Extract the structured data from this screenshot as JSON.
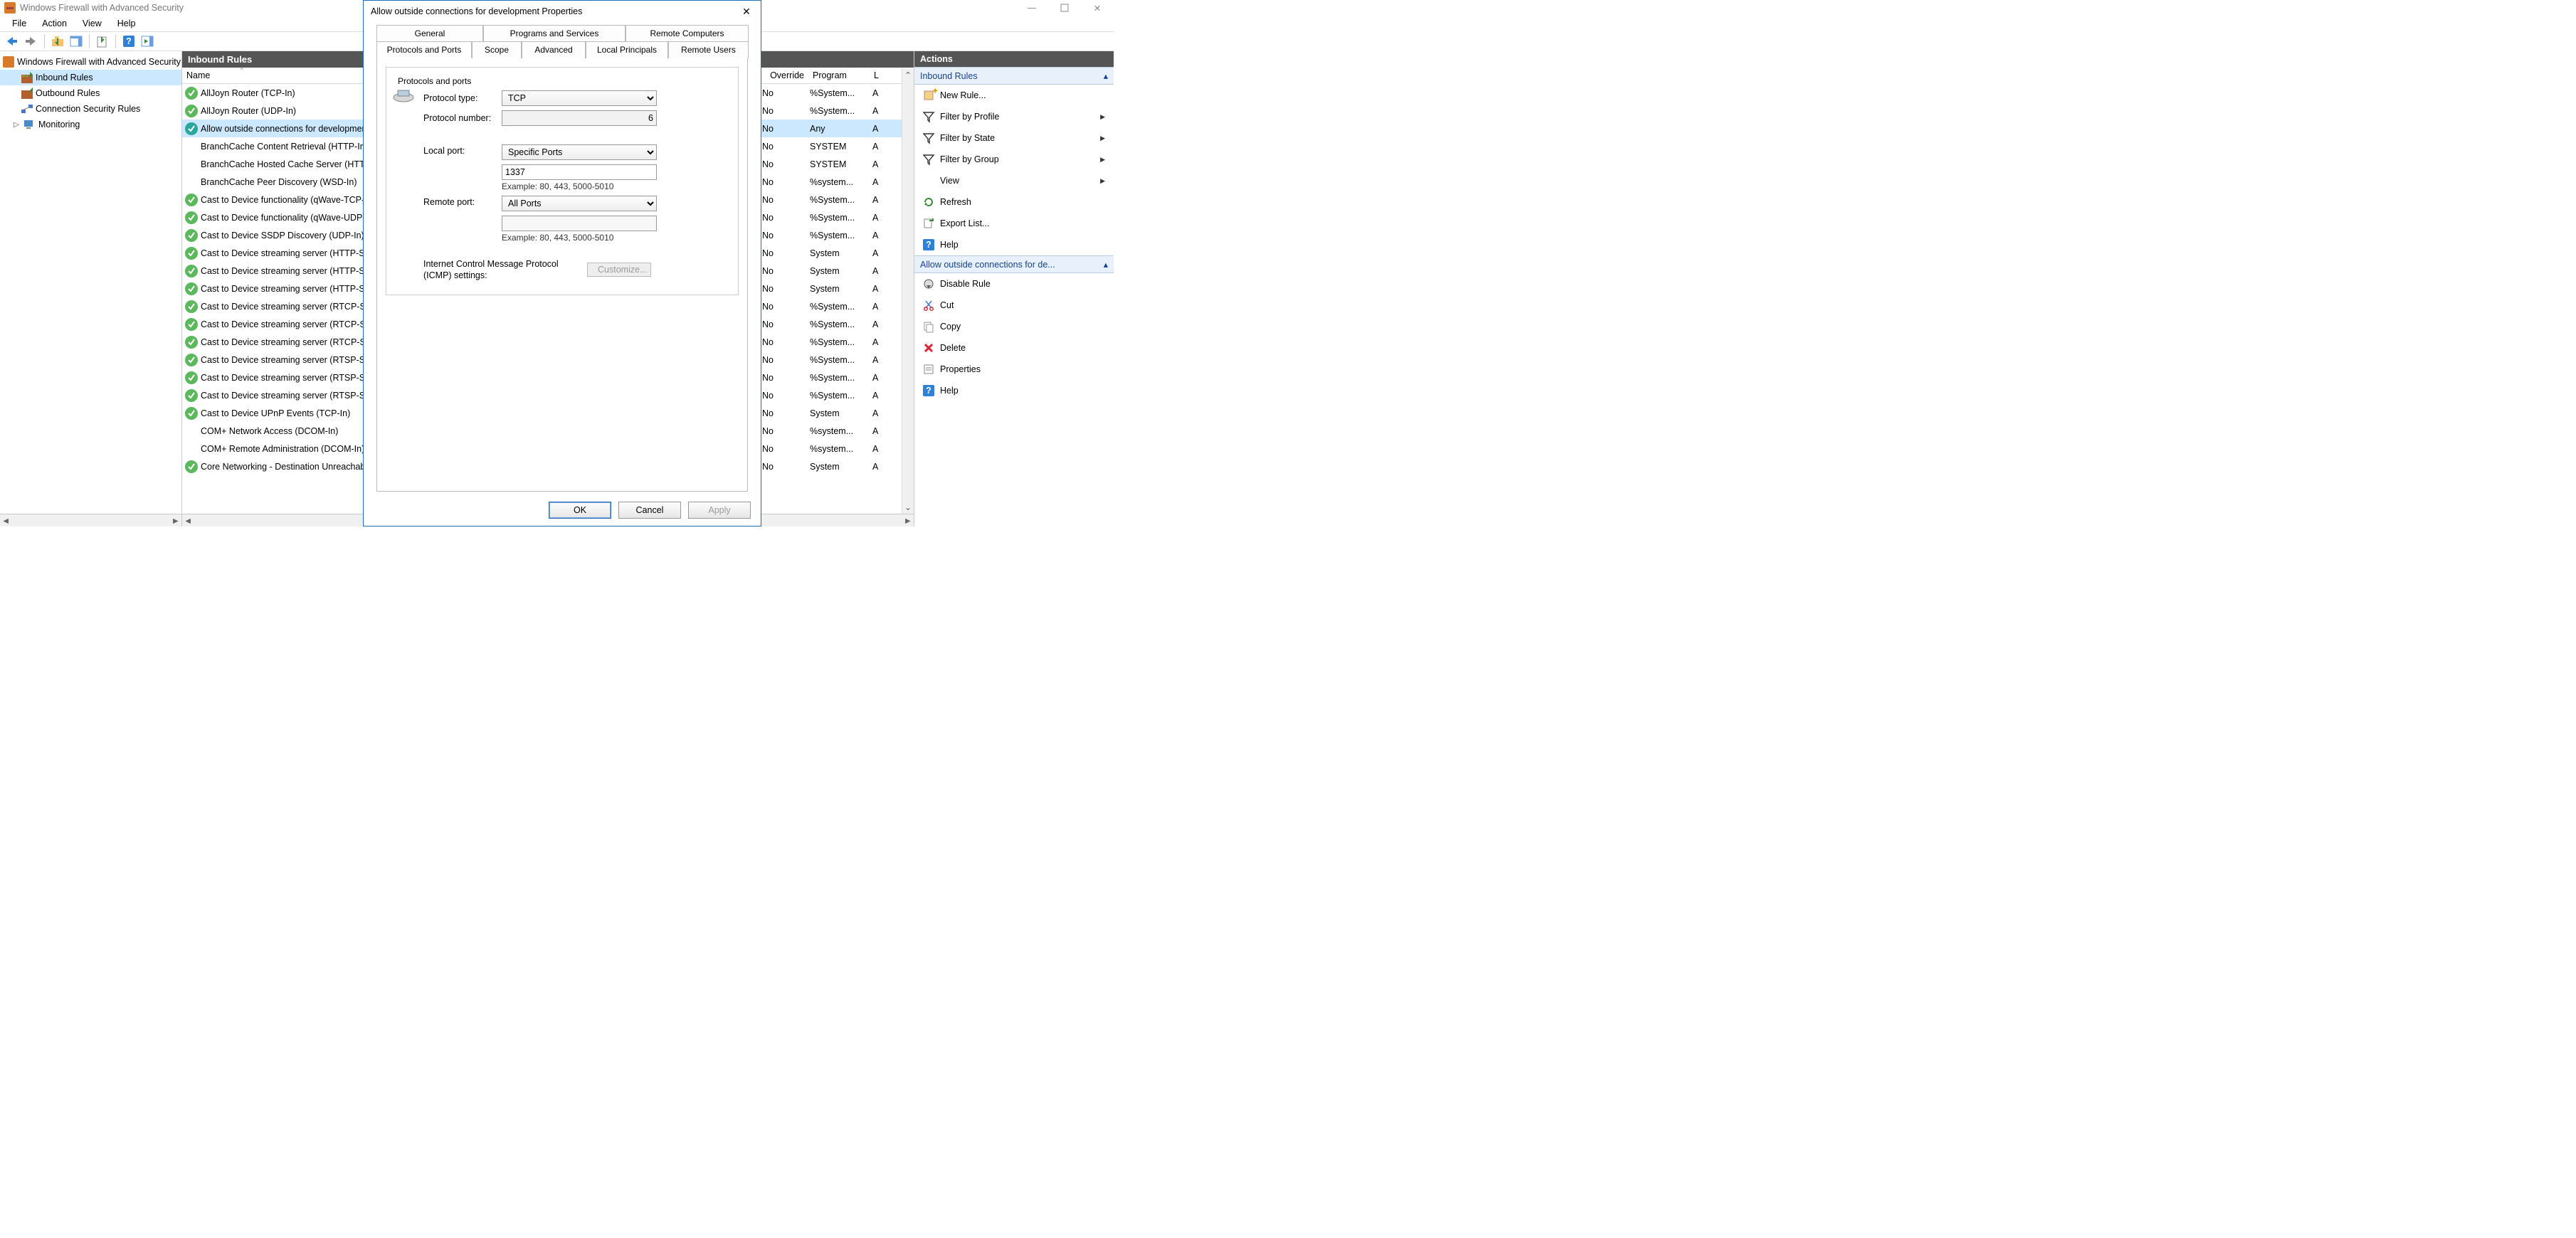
{
  "window": {
    "title": "Windows Firewall with Advanced Security"
  },
  "menus": {
    "file": "File",
    "action": "Action",
    "view": "View",
    "help": "Help"
  },
  "tree": {
    "root": "Windows Firewall with Advanced Security",
    "items": [
      {
        "label": "Inbound Rules"
      },
      {
        "label": "Outbound Rules"
      },
      {
        "label": "Connection Security Rules"
      },
      {
        "label": "Monitoring"
      }
    ]
  },
  "list": {
    "title": "Inbound Rules",
    "cols": {
      "name": "Name",
      "override": "Override",
      "program": "Program",
      "l": "L"
    },
    "rows": [
      {
        "icon": "green",
        "name": "AllJoyn Router (TCP-In)",
        "o": "No",
        "prog": "%System...",
        "l": "A"
      },
      {
        "icon": "green",
        "name": "AllJoyn Router (UDP-In)",
        "o": "No",
        "prog": "%System...",
        "l": "A"
      },
      {
        "icon": "teal",
        "name": "Allow outside connections for development",
        "o": "No",
        "prog": "Any",
        "l": "A",
        "selected": true
      },
      {
        "icon": "none",
        "name": "BranchCache Content Retrieval (HTTP-In)",
        "o": "No",
        "prog": "SYSTEM",
        "l": "A"
      },
      {
        "icon": "none",
        "name": "BranchCache Hosted Cache Server (HTTP-In)",
        "o": "No",
        "prog": "SYSTEM",
        "l": "A"
      },
      {
        "icon": "none",
        "name": "BranchCache Peer Discovery (WSD-In)",
        "o": "No",
        "prog": "%system...",
        "l": "A"
      },
      {
        "icon": "green",
        "name": "Cast to Device functionality (qWave-TCP-In)",
        "o": "No",
        "prog": "%System...",
        "l": "A"
      },
      {
        "icon": "green",
        "name": "Cast to Device functionality (qWave-UDP-In)",
        "o": "No",
        "prog": "%System...",
        "l": "A"
      },
      {
        "icon": "green",
        "name": "Cast to Device SSDP Discovery (UDP-In)",
        "o": "No",
        "prog": "%System...",
        "l": "A"
      },
      {
        "icon": "green",
        "name": "Cast to Device streaming server (HTTP-Streaming-In)",
        "o": "No",
        "prog": "System",
        "l": "A"
      },
      {
        "icon": "green",
        "name": "Cast to Device streaming server (HTTP-Streaming-In)",
        "o": "No",
        "prog": "System",
        "l": "A"
      },
      {
        "icon": "green",
        "name": "Cast to Device streaming server (HTTP-Streaming-In)",
        "o": "No",
        "prog": "System",
        "l": "A"
      },
      {
        "icon": "green",
        "name": "Cast to Device streaming server (RTCP-Streaming-In)",
        "o": "No",
        "prog": "%System...",
        "l": "A"
      },
      {
        "icon": "green",
        "name": "Cast to Device streaming server (RTCP-Streaming-In)",
        "o": "No",
        "prog": "%System...",
        "l": "A"
      },
      {
        "icon": "green",
        "name": "Cast to Device streaming server (RTCP-Streaming-In)",
        "o": "No",
        "prog": "%System...",
        "l": "A"
      },
      {
        "icon": "green",
        "name": "Cast to Device streaming server (RTSP-Streaming-In)",
        "o": "No",
        "prog": "%System...",
        "l": "A"
      },
      {
        "icon": "green",
        "name": "Cast to Device streaming server (RTSP-Streaming-In)",
        "o": "No",
        "prog": "%System...",
        "l": "A"
      },
      {
        "icon": "green",
        "name": "Cast to Device streaming server (RTSP-Streaming-In)",
        "o": "No",
        "prog": "%System...",
        "l": "A"
      },
      {
        "icon": "green",
        "name": "Cast to Device UPnP Events (TCP-In)",
        "o": "No",
        "prog": "System",
        "l": "A"
      },
      {
        "icon": "none",
        "name": "COM+ Network Access (DCOM-In)",
        "o": "No",
        "prog": "%system...",
        "l": "A"
      },
      {
        "icon": "none",
        "name": "COM+ Remote Administration (DCOM-In)",
        "o": "No",
        "prog": "%system...",
        "l": "A"
      },
      {
        "icon": "green",
        "name": "Core Networking - Destination Unreachable",
        "o": "No",
        "prog": "System",
        "l": "A"
      }
    ]
  },
  "actions": {
    "header": "Actions",
    "section1": "Inbound Rules",
    "items1": [
      {
        "icon": "new-rule",
        "label": "New Rule..."
      },
      {
        "icon": "filter",
        "label": "Filter by Profile",
        "arrow": true
      },
      {
        "icon": "filter",
        "label": "Filter by State",
        "arrow": true
      },
      {
        "icon": "filter",
        "label": "Filter by Group",
        "arrow": true
      },
      {
        "icon": "blank",
        "label": "View",
        "arrow": true
      },
      {
        "icon": "refresh",
        "label": "Refresh"
      },
      {
        "icon": "export",
        "label": "Export List..."
      },
      {
        "icon": "help",
        "label": "Help"
      }
    ],
    "section2": "Allow outside connections for de...",
    "items2": [
      {
        "icon": "disable",
        "label": "Disable Rule"
      },
      {
        "icon": "cut",
        "label": "Cut"
      },
      {
        "icon": "copy",
        "label": "Copy"
      },
      {
        "icon": "delete",
        "label": "Delete"
      },
      {
        "icon": "props",
        "label": "Properties"
      },
      {
        "icon": "help",
        "label": "Help"
      }
    ]
  },
  "dialog": {
    "title": "Allow outside connections for development Properties",
    "tabs_row1": {
      "general": "General",
      "programs": "Programs and Services",
      "remote": "Remote Computers"
    },
    "tabs_row2": {
      "protocols": "Protocols and Ports",
      "scope": "Scope",
      "advanced": "Advanced",
      "local_principals": "Local Principals",
      "remote_users": "Remote Users"
    },
    "group_label": "Protocols and ports",
    "protocol_type_lbl": "Protocol type:",
    "protocol_type_val": "TCP",
    "protocol_num_lbl": "Protocol number:",
    "protocol_num_val": "6",
    "local_port_lbl": "Local port:",
    "local_port_mode": "Specific Ports",
    "local_port_val": "1337",
    "example_text": "Example: 80, 443, 5000-5010",
    "remote_port_lbl": "Remote port:",
    "remote_port_mode": "All Ports",
    "remote_port_val": "",
    "icmp_lbl": "Internet Control Message Protocol (ICMP) settings:",
    "customize_btn": "Customize...",
    "ok": "OK",
    "cancel": "Cancel",
    "apply": "Apply"
  }
}
